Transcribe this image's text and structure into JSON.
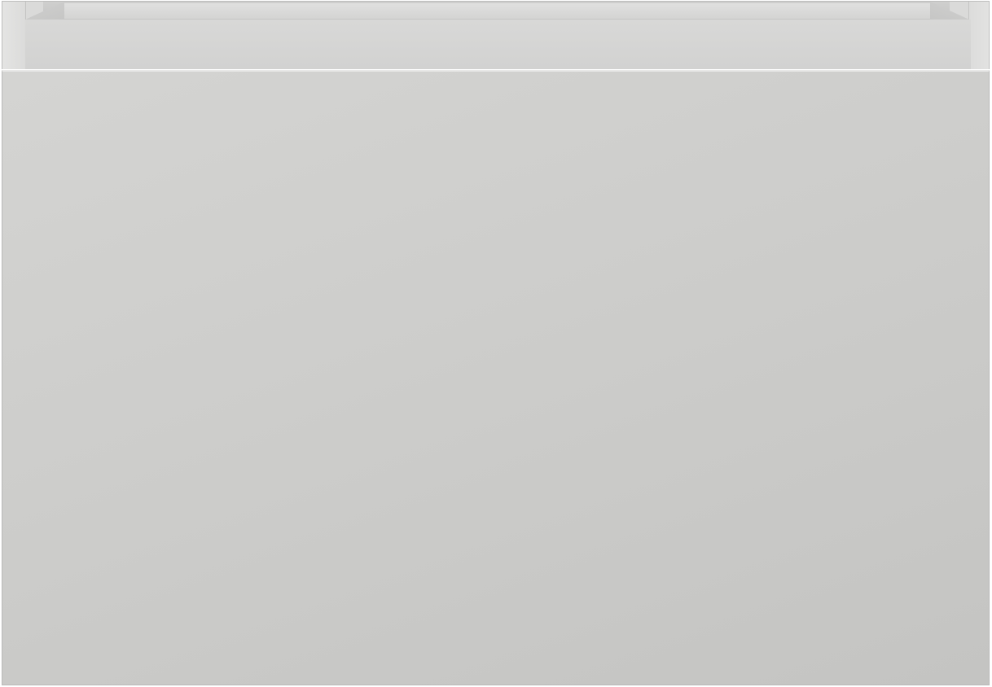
{
  "scene": {
    "subject": "cabinet-drawer",
    "colors": {
      "panel": "#cdcdcb",
      "panel_light": "#d4d4d2",
      "panel_dark": "#c4c4c2",
      "edge": "#b9b9b8",
      "background": "#ffffff"
    }
  }
}
